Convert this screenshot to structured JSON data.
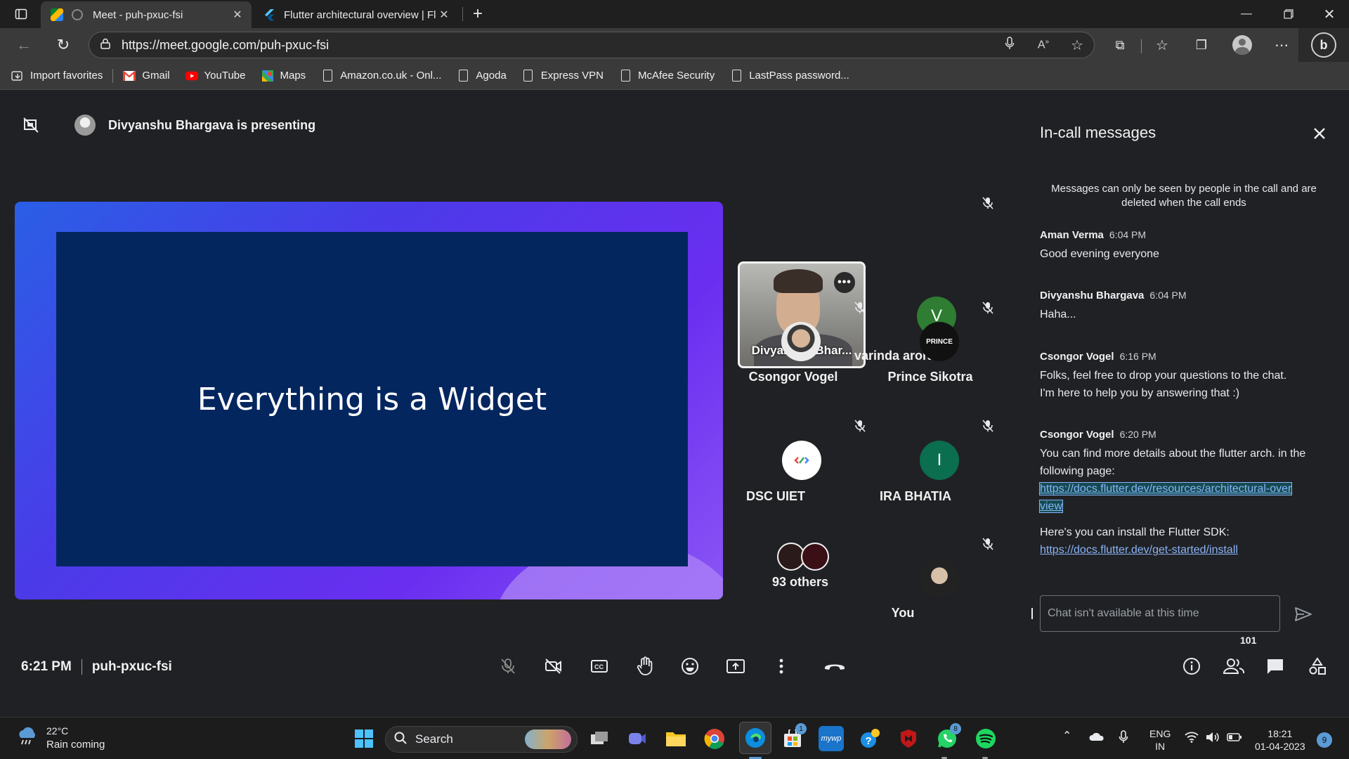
{
  "browser": {
    "tabs": [
      {
        "title": "Meet - puh-pxuc-fsi",
        "active": true
      },
      {
        "title": "Flutter architectural overview | Fl",
        "active": false
      }
    ],
    "url": "https://meet.google.com/puh-pxuc-fsi",
    "favorites": [
      {
        "label": "Import favorites",
        "icon": "import-icon"
      },
      {
        "label": "Gmail",
        "icon": "gmail-icon"
      },
      {
        "label": "YouTube",
        "icon": "youtube-icon"
      },
      {
        "label": "Maps",
        "icon": "maps-icon"
      },
      {
        "label": "Amazon.co.uk - Onl...",
        "icon": "page-icon"
      },
      {
        "label": "Agoda",
        "icon": "page-icon"
      },
      {
        "label": "Express VPN",
        "icon": "page-icon"
      },
      {
        "label": "McAfee Security",
        "icon": "page-icon"
      },
      {
        "label": "LastPass password...",
        "icon": "page-icon"
      }
    ]
  },
  "meet": {
    "presenting_text": "Divyanshu Bhargava is presenting",
    "slide_text": "Everything is a Widget",
    "participants": [
      {
        "name": "Divyanshu Bhar...",
        "type": "video"
      },
      {
        "name": "varinda arora",
        "initial": "V",
        "color": "#1e8e3e",
        "muted": true
      },
      {
        "name": "Csongor Vogel",
        "muted": true
      },
      {
        "name": "Prince Sikotra",
        "muted": true
      },
      {
        "name": "DSC UIET",
        "muted": true
      },
      {
        "name": "IRA BHATIA",
        "initial": "I",
        "color": "#0b6e4f",
        "muted": true
      },
      {
        "name": "93 others"
      },
      {
        "name": "You",
        "muted": true
      }
    ],
    "time": "6:21 PM",
    "meeting_code": "puh-pxuc-fsi",
    "people_count": "101"
  },
  "chat": {
    "title": "In-call messages",
    "note": "Messages can only be seen by people in the call and are deleted when the call ends",
    "messages": [
      {
        "sender": "Aman Verma",
        "time": "6:04 PM",
        "text": "Good evening everyone"
      },
      {
        "sender": "Divyanshu Bhargava",
        "time": "6:04 PM",
        "text": "Haha..."
      },
      {
        "sender": "Csongor Vogel",
        "time": "6:16 PM",
        "text": "Folks, feel free to drop your questions to the chat. I'm here to help you by answering that :)"
      },
      {
        "sender": "Csongor Vogel",
        "time": "6:20 PM",
        "text": "You can find more details about the flutter arch. in the following page:",
        "link": "https://docs.flutter.dev/resources/architectural-overview",
        "text2": "Here's you can install the Flutter SDK:",
        "link2": "https://docs.flutter.dev/get-started/install"
      }
    ],
    "input_placeholder": "Chat isn't available at this time"
  },
  "taskbar": {
    "weather_temp": "22°C",
    "weather_desc": "Rain coming",
    "search_label": "Search",
    "lang_1": "ENG",
    "lang_2": "IN",
    "clock_time": "18:21",
    "clock_date": "01-04-2023",
    "notification_count": "9",
    "store_badge": "1",
    "whatsapp_badge": "8"
  }
}
